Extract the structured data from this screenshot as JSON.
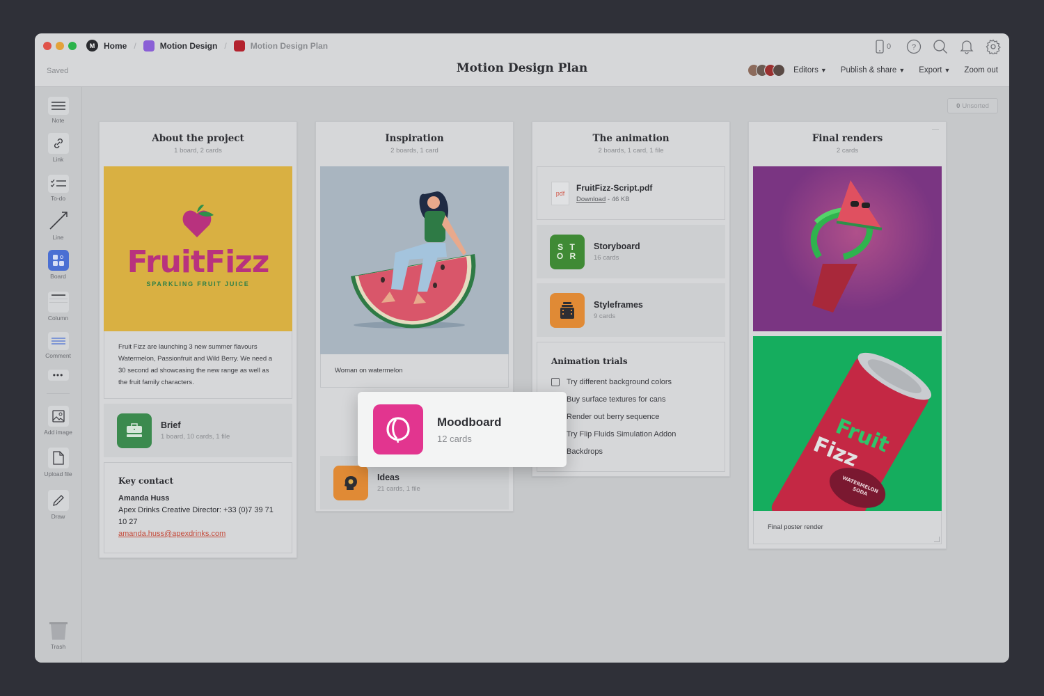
{
  "window": {
    "traffic_lights": {
      "close": "#e0534a",
      "minimize": "#e3a23a",
      "maximize": "#2bb34a"
    },
    "breadcrumb": [
      {
        "label": "Home",
        "icon": "milanote-logo-icon"
      },
      {
        "label": "Motion Design",
        "icon": "purple-board-icon",
        "color": "#8a5fd6"
      },
      {
        "label": "Motion Design Plan",
        "icon": "red-board-icon",
        "color": "#b3222e"
      }
    ],
    "status": "Saved",
    "title": "Motion Design Plan",
    "mobile_count": "0",
    "actions": {
      "editors": "Editors",
      "publish": "Publish & share",
      "export": "Export",
      "zoom_out": "Zoom out"
    }
  },
  "toolbar": {
    "items": [
      {
        "label": "Note",
        "icon": "note-icon"
      },
      {
        "label": "Link",
        "icon": "link-icon"
      },
      {
        "label": "To-do",
        "icon": "todo-icon"
      },
      {
        "label": "Line",
        "icon": "line-icon"
      },
      {
        "label": "Board",
        "icon": "board-icon"
      },
      {
        "label": "Column",
        "icon": "column-icon"
      },
      {
        "label": "Comment",
        "icon": "comment-icon"
      },
      {
        "label": "",
        "icon": "more-icon"
      },
      {
        "label": "Add image",
        "icon": "image-icon"
      },
      {
        "label": "Upload file",
        "icon": "file-icon"
      },
      {
        "label": "Draw",
        "icon": "pencil-icon"
      },
      {
        "label": "Trash",
        "icon": "trash-icon"
      }
    ]
  },
  "canvas": {
    "unsorted": {
      "count": "0",
      "label": "Unsorted"
    },
    "columns": [
      {
        "title": "About the project",
        "subtitle": "1 board, 2 cards",
        "image": {
          "brand": "FruitFizz",
          "tagline": "SPARKLING FRUIT JUICE"
        },
        "note": "Fruit Fizz are launching 3 new summer flavours Watermelon, Passionfruit and Wild Berry. We need a 30 second ad showcasing the new range as well as the fruit family characters.",
        "board": {
          "name": "Brief",
          "meta": "1 board, 10 cards, 1 file",
          "color": "#3b8a4e"
        },
        "contact": {
          "heading": "Key contact",
          "name": "Amanda Huss",
          "role": "Apex Drinks Creative Director: +33 (0)7 39 71 10 27",
          "email": "amanda.huss@apexdrinks.com"
        }
      },
      {
        "title": "Inspiration",
        "subtitle": "2 boards, 1 card",
        "image_caption": "Woman on watermelon",
        "board": {
          "name": "Ideas",
          "meta": "21 cards, 1 file",
          "color": "#e08a35"
        }
      },
      {
        "title": "The animation",
        "subtitle": "2 boards, 1 card, 1 file",
        "file": {
          "name": "FruitFizz-Script.pdf",
          "type": "pdf",
          "download": "Download",
          "size": "46 KB"
        },
        "boards": [
          {
            "name": "Storyboard",
            "meta": "16 cards",
            "color": "#3f8a35",
            "icon_text": "S T\nO R"
          },
          {
            "name": "Styleframes",
            "meta": "9 cards",
            "color": "#e08a35"
          }
        ],
        "todo": {
          "heading": "Animation trials",
          "items": [
            {
              "label": "Try different background colors",
              "checked": false
            },
            {
              "label": "Buy surface textures for cans",
              "checked": false
            },
            {
              "label": "Render out berry sequence",
              "checked": false
            },
            {
              "label": "Try Flip Fluids Simulation Addon",
              "checked": false
            },
            {
              "label": "Backdrops",
              "checked": false
            }
          ]
        }
      },
      {
        "title": "Final renders",
        "subtitle": "2 cards",
        "images": [
          {
            "alt": "Watermelon character with can",
            "bg": "#7a3582"
          },
          {
            "alt": "Fruit Fizz watermelon soda can",
            "bg": "#15ad5e",
            "can_text": [
              "Fruit",
              "Fizz",
              "WATERMELON",
              "SODA"
            ]
          }
        ],
        "image_caption": "Final poster render"
      }
    ],
    "dragging_card": {
      "name": "Moodboard",
      "meta": "12 cards",
      "color": "#e2358f"
    }
  }
}
